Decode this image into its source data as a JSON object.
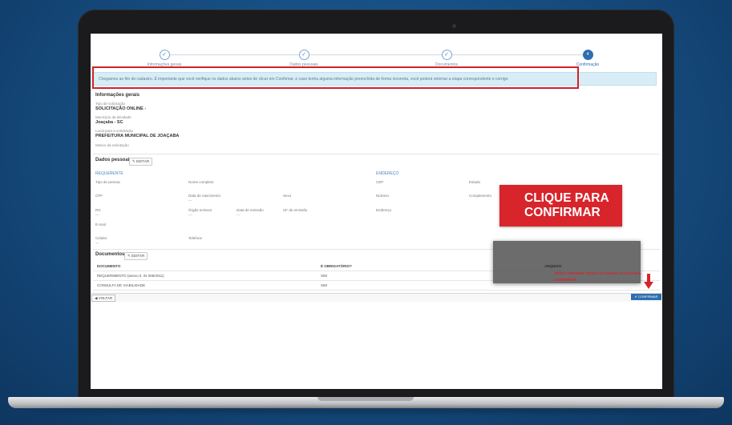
{
  "stepper": {
    "steps": [
      {
        "label": "Informações gerais",
        "icon": "check-icon"
      },
      {
        "label": "Dados pessoais",
        "icon": "check-icon"
      },
      {
        "label": "Documentos",
        "icon": "check-icon"
      },
      {
        "label": "Confirmação",
        "number": "4"
      }
    ]
  },
  "banner": {
    "text": "Chegamos ao fim do cadastro. É importante que você verifique os dados abaixo antes de clicar em Confirmar, e caso tenha alguma informação preenchida de forma incorreta, você poderá retornar a etapa correspondente e corrigir."
  },
  "general": {
    "title": "Informações gerais",
    "fields": [
      {
        "label": "Tipo de solicitação",
        "value": "SOLICITAÇÃO ONLINE -"
      },
      {
        "label": "Município da atividade",
        "value": "Joaçaba - SC"
      },
      {
        "label": "Local para a solicitação",
        "value": "PREFEITURA MUNICIPAL DE JOAÇABA"
      },
      {
        "label": "Motivo da solicitação",
        "value": ""
      }
    ]
  },
  "personal": {
    "title": "Dados pessoais",
    "edit_label": "EDITAR",
    "requester_head": "REQUERENTE",
    "address_head": "ENDEREÇO",
    "labels": {
      "tipo_pessoa": "Tipo de pessoa",
      "nome": "Nome completo",
      "cpf": "CPF",
      "nascimento": "Data de nascimento",
      "sexo": "Sexo",
      "rg": "RG",
      "orgao": "Órgão emissor",
      "data_emissao": "Data de emissão",
      "uf": "UF de emissão",
      "email": "E-mail",
      "celular": "Celular",
      "telefone": "Telefone",
      "cep": "CEP",
      "estado": "Estado",
      "numero": "Número",
      "complemento": "Complemento",
      "endereco": "Endereço"
    },
    "dash": "—"
  },
  "documents": {
    "title": "Documentos",
    "edit_label": "EDITAR",
    "headers": [
      "DOCUMENTO",
      "É OBRIGATÓRIO?",
      "ARQUIVO"
    ],
    "rows": [
      {
        "name": "REQUERIMENTO (anexo II, IN 008/2011)",
        "required": "SIM"
      },
      {
        "name": "CONSULTA DE VIABILIDADE",
        "required": "SIM"
      }
    ]
  },
  "actions": {
    "back_label": "VOLTAR",
    "confirm_label": "CONFIRMAR"
  },
  "annotations": {
    "callout": "CLIQUE PARA CONFIRMAR",
    "note": "APÓS CONFERIR TODOS OS DADOS CLICK PARA CONFIRMAR",
    "accent": "#d8242b"
  }
}
